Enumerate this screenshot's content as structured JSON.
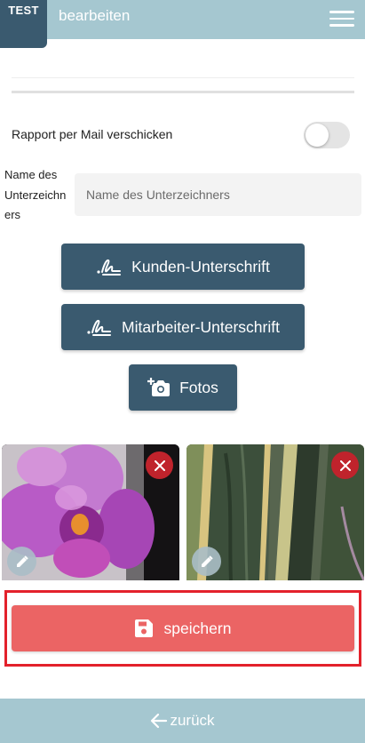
{
  "header": {
    "env_badge": "TEST",
    "title": "bearbeiten",
    "menu_icon": "hamburger-menu-icon"
  },
  "form": {
    "mail_report_label": "Rapport per Mail verschicken",
    "mail_report_enabled": false,
    "signer_name_label": "Name des Unterzeichners",
    "signer_name_placeholder": "Name des Unterzeichners",
    "signer_name_value": ""
  },
  "buttons": {
    "kunden_signature": "Kunden-Unterschrift",
    "mitarbeiter_signature": "Mitarbeiter-Unterschrift",
    "fotos": "Fotos",
    "save": "speichern",
    "back": "zurück"
  },
  "photos": [
    {
      "subject": "orchid-flower",
      "delete_icon": "close-icon",
      "edit_icon": "pencil-icon"
    },
    {
      "subject": "snake-plant-leaves",
      "delete_icon": "close-icon",
      "edit_icon": "pencil-icon"
    }
  ],
  "colors": {
    "primary": "#3a5a6f",
    "header_footer": "#a5c7d0",
    "save_button": "#eb6464",
    "delete": "#c0232c",
    "highlight": "#e3212b"
  }
}
